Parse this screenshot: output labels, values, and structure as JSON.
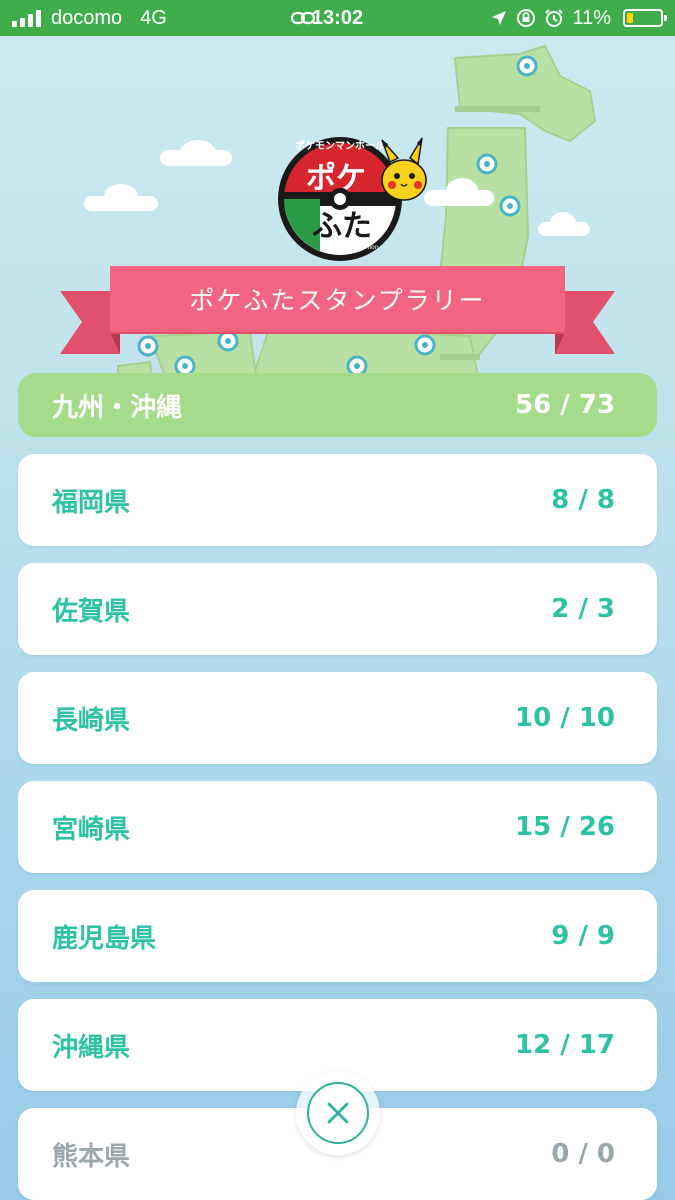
{
  "status_bar": {
    "carrier": "docomo",
    "network": "4G",
    "time": "13:02",
    "battery_percent_label": "11%",
    "battery_level": 0.11,
    "icons": [
      "signal-icon",
      "link-icon",
      "location-arrow-icon",
      "rotation-lock-icon",
      "alarm-icon",
      "battery-icon"
    ]
  },
  "logo": {
    "top_text": "ポケモンマンホール",
    "main_text_1": "ポケ",
    "main_text_2": "ふた",
    "small_text": "©Pokémon"
  },
  "banner": {
    "title": "ポケふたスタンプラリー"
  },
  "region": {
    "name": "九州・沖縄",
    "count": "56 / 73"
  },
  "prefectures": [
    {
      "name": "福岡県",
      "count": "8 / 8"
    },
    {
      "name": "佐賀県",
      "count": "2 / 3"
    },
    {
      "name": "長崎県",
      "count": "10 / 10"
    },
    {
      "name": "宮崎県",
      "count": "15 / 26"
    },
    {
      "name": "鹿児島県",
      "count": "9 / 9"
    },
    {
      "name": "沖縄県",
      "count": "12 / 17"
    },
    {
      "name": "熊本県",
      "count": "0 / 0"
    }
  ],
  "colors": {
    "status_bar": "#3fae4a",
    "accent_teal": "#2cc2a3",
    "region_green": "#a5dc8c",
    "ribbon_pink": "#f2647f",
    "inactive_gray": "#9aa7ab"
  },
  "close_button": {
    "icon": "close-icon"
  }
}
